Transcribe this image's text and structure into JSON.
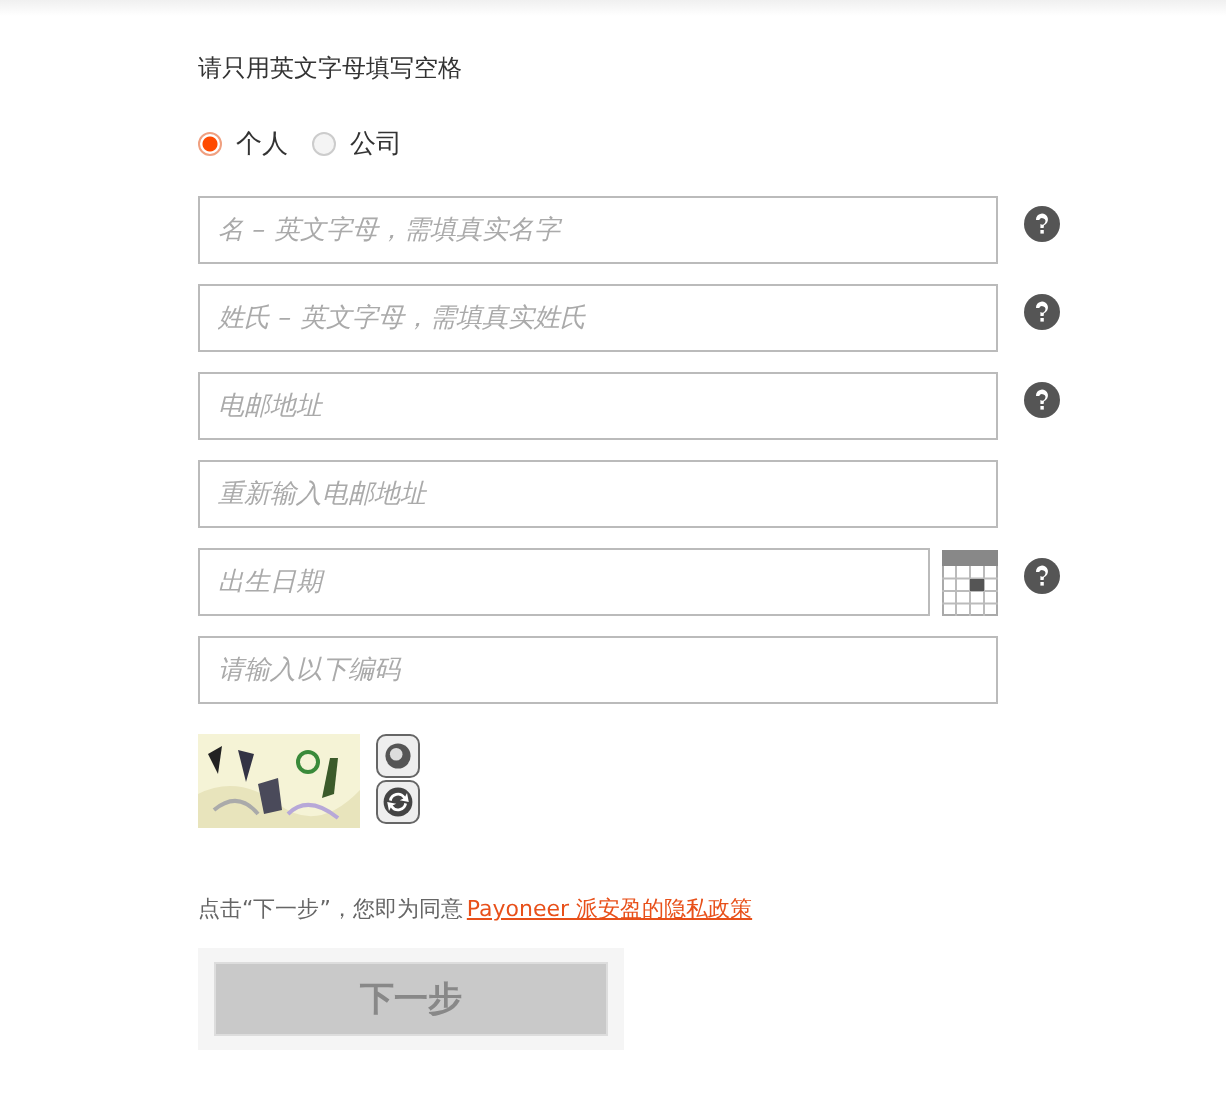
{
  "note": "请只用英文字母填写空格",
  "account_types": [
    {
      "label": "个人",
      "selected": true
    },
    {
      "label": "公司",
      "selected": false
    }
  ],
  "fields": [
    {
      "kind": "text",
      "placeholder": "名 – 英文字母，需填真实名字",
      "help": true
    },
    {
      "kind": "text",
      "placeholder": "姓氏 – 英文字母，需填真实姓氏",
      "help": true
    },
    {
      "kind": "text",
      "placeholder": "电邮地址",
      "help": true
    },
    {
      "kind": "text",
      "placeholder": "重新输入电邮地址",
      "help": false
    },
    {
      "kind": "date",
      "placeholder": "出生日期",
      "help": true
    },
    {
      "kind": "text",
      "placeholder": "请输入以下编码",
      "help": false
    }
  ],
  "consent": {
    "text": "点击“下一步”，您即为同意",
    "link": "Payoneer 派安盈的隐私政策"
  },
  "next_button": {
    "label": "下一步",
    "disabled": true
  }
}
